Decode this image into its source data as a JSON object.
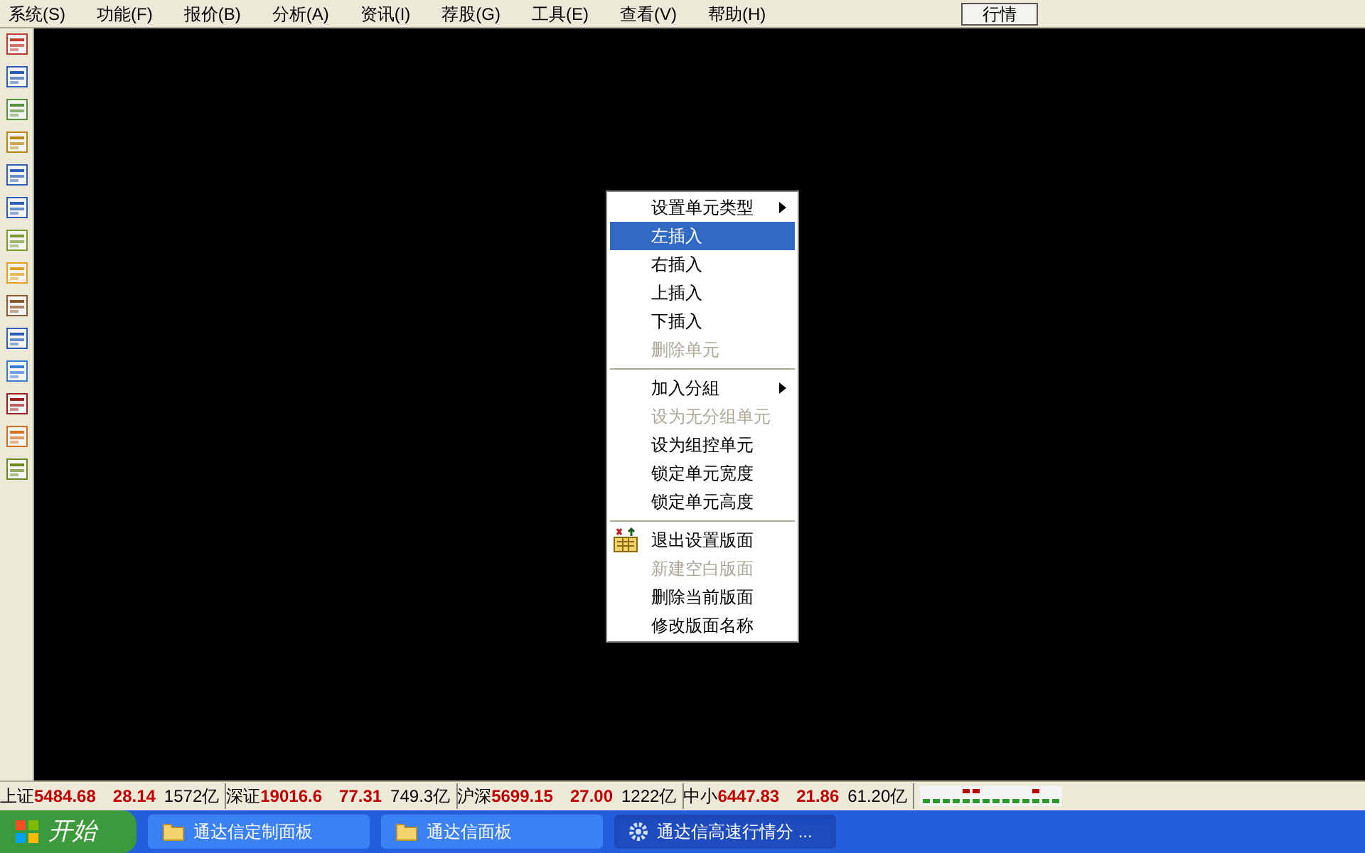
{
  "menubar": {
    "items": [
      "系统(S)",
      "功能(F)",
      "报价(B)",
      "分析(A)",
      "资讯(I)",
      "荐股(G)",
      "工具(E)",
      "查看(V)",
      "帮助(H)"
    ],
    "mode_button": "行情"
  },
  "context_menu": {
    "items": [
      {
        "kind": "item",
        "label": "设置单元类型",
        "submenu": true,
        "disabled": false,
        "selected": false
      },
      {
        "kind": "item",
        "label": "左插入",
        "submenu": false,
        "disabled": false,
        "selected": true
      },
      {
        "kind": "item",
        "label": "右插入",
        "submenu": false,
        "disabled": false,
        "selected": false
      },
      {
        "kind": "item",
        "label": "上插入",
        "submenu": false,
        "disabled": false,
        "selected": false
      },
      {
        "kind": "item",
        "label": "下插入",
        "submenu": false,
        "disabled": false,
        "selected": false
      },
      {
        "kind": "item",
        "label": "删除单元",
        "submenu": false,
        "disabled": true,
        "selected": false
      },
      {
        "kind": "separator"
      },
      {
        "kind": "item",
        "label": "加入分組",
        "submenu": true,
        "disabled": false,
        "selected": false
      },
      {
        "kind": "item",
        "label": "设为无分组单元",
        "submenu": false,
        "disabled": true,
        "selected": false
      },
      {
        "kind": "item",
        "label": "设为组控单元",
        "submenu": false,
        "disabled": false,
        "selected": false
      },
      {
        "kind": "item",
        "label": "锁定单元宽度",
        "submenu": false,
        "disabled": false,
        "selected": false
      },
      {
        "kind": "item",
        "label": "锁定单元高度",
        "submenu": false,
        "disabled": false,
        "selected": false
      },
      {
        "kind": "separator"
      },
      {
        "kind": "item",
        "label": "退出设置版面",
        "submenu": false,
        "disabled": false,
        "selected": false,
        "icon": true
      },
      {
        "kind": "item",
        "label": "新建空白版面",
        "submenu": false,
        "disabled": true,
        "selected": false
      },
      {
        "kind": "item",
        "label": "删除当前版面",
        "submenu": false,
        "disabled": false,
        "selected": false
      },
      {
        "kind": "item",
        "label": "修改版面名称",
        "submenu": false,
        "disabled": false,
        "selected": false
      }
    ]
  },
  "status_bar": {
    "indices": [
      {
        "name": "上证",
        "value": "5484.68",
        "change": "28.14",
        "amount": "1572亿"
      },
      {
        "name": "深证",
        "value": "19016.6",
        "change": "77.31",
        "amount": "749.3亿"
      },
      {
        "name": "沪深",
        "value": "5699.15",
        "change": "27.00",
        "amount": "1222亿"
      },
      {
        "name": "中小",
        "value": "6447.83",
        "change": "21.86",
        "amount": "61.20亿"
      }
    ]
  },
  "taskbar": {
    "start": "开始",
    "tasks": [
      {
        "kind": "folder",
        "label": "通达信定制面板",
        "selected": false
      },
      {
        "kind": "folder",
        "label": "通达信面板",
        "selected": false
      },
      {
        "kind": "app",
        "label": "通达信高速行情分 ...",
        "selected": true
      }
    ]
  }
}
